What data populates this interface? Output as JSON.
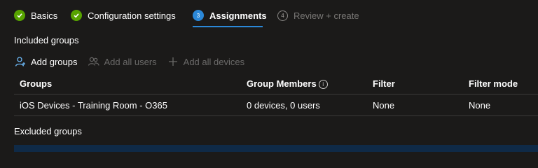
{
  "wizard": {
    "steps": [
      {
        "label": "Basics",
        "state": "done",
        "number": "1"
      },
      {
        "label": "Configuration settings",
        "state": "done",
        "number": "2"
      },
      {
        "label": "Assignments",
        "state": "active",
        "number": "3"
      },
      {
        "label": "Review + create",
        "state": "pending",
        "number": "4"
      }
    ]
  },
  "included": {
    "title": "Included groups",
    "toolbar": {
      "add_groups": "Add groups",
      "add_all_users": "Add all users",
      "add_all_devices": "Add all devices"
    },
    "table": {
      "columns": [
        "Groups",
        "Group Members",
        "Filter",
        "Filter mode"
      ],
      "rows": [
        [
          "iOS Devices - Training Room - O365",
          "0 devices, 0 users",
          "None",
          "None"
        ]
      ]
    }
  },
  "excluded": {
    "title": "Excluded groups"
  },
  "colors": {
    "accent": "#2b88d8",
    "success": "#57a300",
    "background": "#1b1a19"
  }
}
